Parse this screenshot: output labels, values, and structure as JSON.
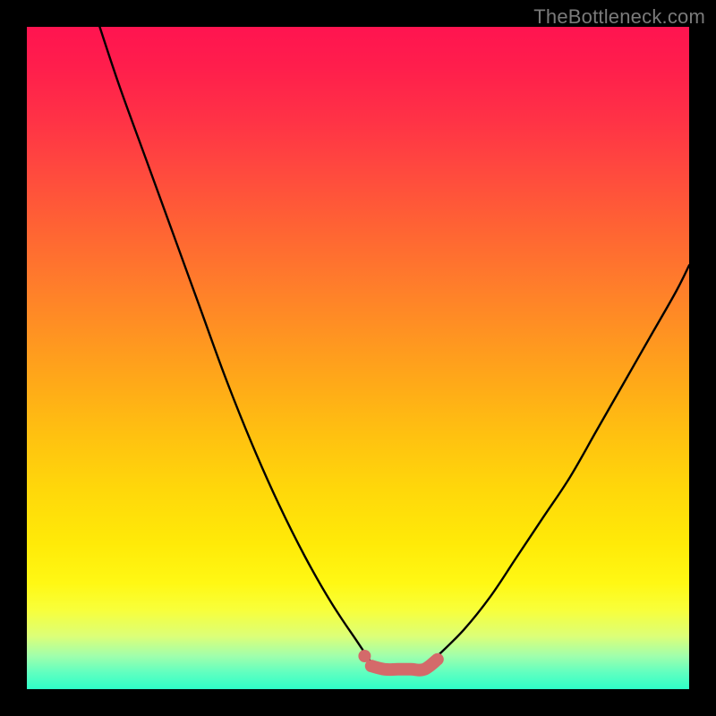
{
  "watermark": "TheBottleneck.com",
  "chart_data": {
    "type": "line",
    "title": "",
    "xlabel": "",
    "ylabel": "",
    "xlim": [
      0,
      100
    ],
    "ylim": [
      0,
      100
    ],
    "grid": false,
    "series": [
      {
        "name": "left-curve",
        "color": "#000000",
        "x": [
          11,
          14,
          18,
          22,
          26,
          30,
          34,
          38,
          42,
          46,
          50,
          52
        ],
        "values": [
          100,
          91,
          80,
          69,
          58,
          47,
          37,
          28,
          20,
          13,
          7,
          4
        ]
      },
      {
        "name": "right-curve",
        "color": "#000000",
        "x": [
          62,
          66,
          70,
          74,
          78,
          82,
          86,
          90,
          94,
          98,
          100
        ],
        "values": [
          5,
          9,
          14,
          20,
          26,
          32,
          39,
          46,
          53,
          60,
          64
        ]
      },
      {
        "name": "flat-segment",
        "color": "#d46a6a",
        "x": [
          52,
          54,
          56,
          58,
          60,
          62
        ],
        "values": [
          3.5,
          3,
          3,
          3,
          3,
          4.5
        ]
      }
    ],
    "markers": [
      {
        "name": "left-dot",
        "x": 51,
        "y": 5,
        "color": "#d46a6a"
      }
    ]
  }
}
